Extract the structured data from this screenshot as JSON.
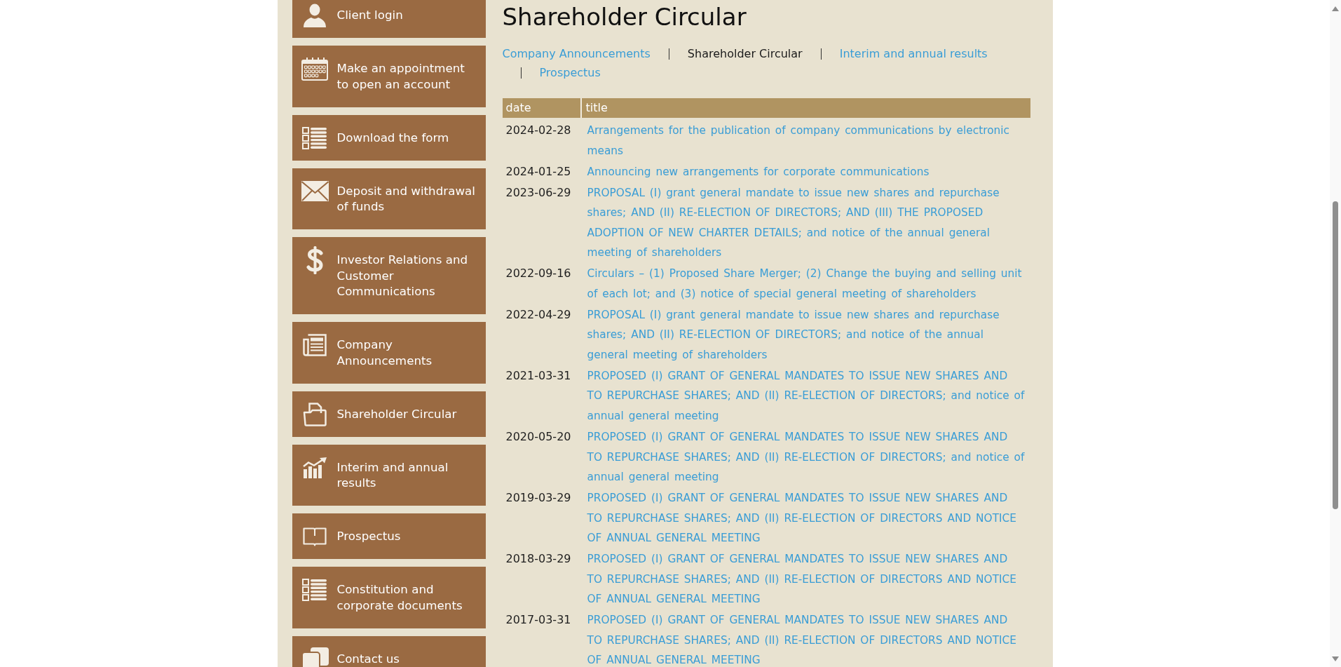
{
  "sidebar": {
    "items": [
      {
        "label": "Client login"
      },
      {
        "label": "Make an appointment to open an account"
      },
      {
        "label": "Download the form"
      },
      {
        "label": "Deposit and withdrawal of funds"
      },
      {
        "label": "Investor Relations and Customer Communications"
      },
      {
        "label": "Company Announcements"
      },
      {
        "label": "Shareholder Circular"
      },
      {
        "label": "Interim and annual results"
      },
      {
        "label": "Prospectus"
      },
      {
        "label": "Constitution and corporate documents"
      },
      {
        "label": "Contact us"
      }
    ]
  },
  "page": {
    "title": "Shareholder Circular"
  },
  "tabs": [
    {
      "label": "Company Announcements",
      "selected": false
    },
    {
      "label": "Shareholder Circular",
      "selected": true
    },
    {
      "label": "Interim and annual results",
      "selected": false
    },
    {
      "label": "Prospectus",
      "selected": false
    }
  ],
  "table": {
    "columns": [
      {
        "label": "date"
      },
      {
        "label": "title"
      }
    ],
    "rows": [
      {
        "date": "2024-02-28",
        "title": "Arrangements for the publication of company communications by electronic means"
      },
      {
        "date": "2024-01-25",
        "title": "Announcing new arrangements for corporate communications"
      },
      {
        "date": "2023-06-29",
        "title": "PROPOSAL (I) grant general mandate to issue new shares and repurchase shares; AND (II) RE-ELECTION OF DIRECTORS; AND (III) THE PROPOSED ADOPTION OF NEW CHARTER DETAILS; and notice of the annual general meeting of shareholders"
      },
      {
        "date": "2022-09-16",
        "title": "Circulars – (1) Proposed Share Merger; (2) Change the buying and selling unit of each lot; and (3) notice of special general meeting of shareholders"
      },
      {
        "date": "2022-04-29",
        "title": "PROPOSAL (I) grant general mandate to issue new shares and repurchase shares; AND (II) RE-ELECTION OF DIRECTORS; and notice of the annual general meeting of shareholders"
      },
      {
        "date": "2021-03-31",
        "title": "PROPOSED (I) GRANT OF GENERAL MANDATES TO ISSUE NEW SHARES AND TO REPURCHASE SHARES; AND (II) RE-ELECTION OF DIRECTORS; and notice of annual general meeting"
      },
      {
        "date": "2020-05-20",
        "title": "PROPOSED (I) GRANT OF GENERAL MANDATES TO ISSUE NEW SHARES AND TO REPURCHASE SHARES; AND (II) RE-ELECTION OF DIRECTORS; and notice of annual general meeting"
      },
      {
        "date": "2019-03-29",
        "title": "PROPOSED (I) GRANT OF GENERAL MANDATES TO ISSUE NEW SHARES AND TO REPURCHASE SHARES; AND (II) RE-ELECTION OF DIRECTORS AND NOTICE OF ANNUAL GENERAL MEETING"
      },
      {
        "date": "2018-03-29",
        "title": "PROPOSED (I) GRANT OF GENERAL MANDATES TO ISSUE NEW SHARES AND TO REPURCHASE SHARES; AND (II) RE-ELECTION OF DIRECTORS AND NOTICE OF ANNUAL GENERAL MEETING"
      },
      {
        "date": "2017-03-31",
        "title": "PROPOSED (I) GRANT OF GENERAL MANDATES TO ISSUE NEW SHARES AND TO REPURCHASE SHARES; AND (II) RE-ELECTION OF DIRECTORS AND NOTICE OF ANNUAL GENERAL MEETING"
      }
    ]
  }
}
